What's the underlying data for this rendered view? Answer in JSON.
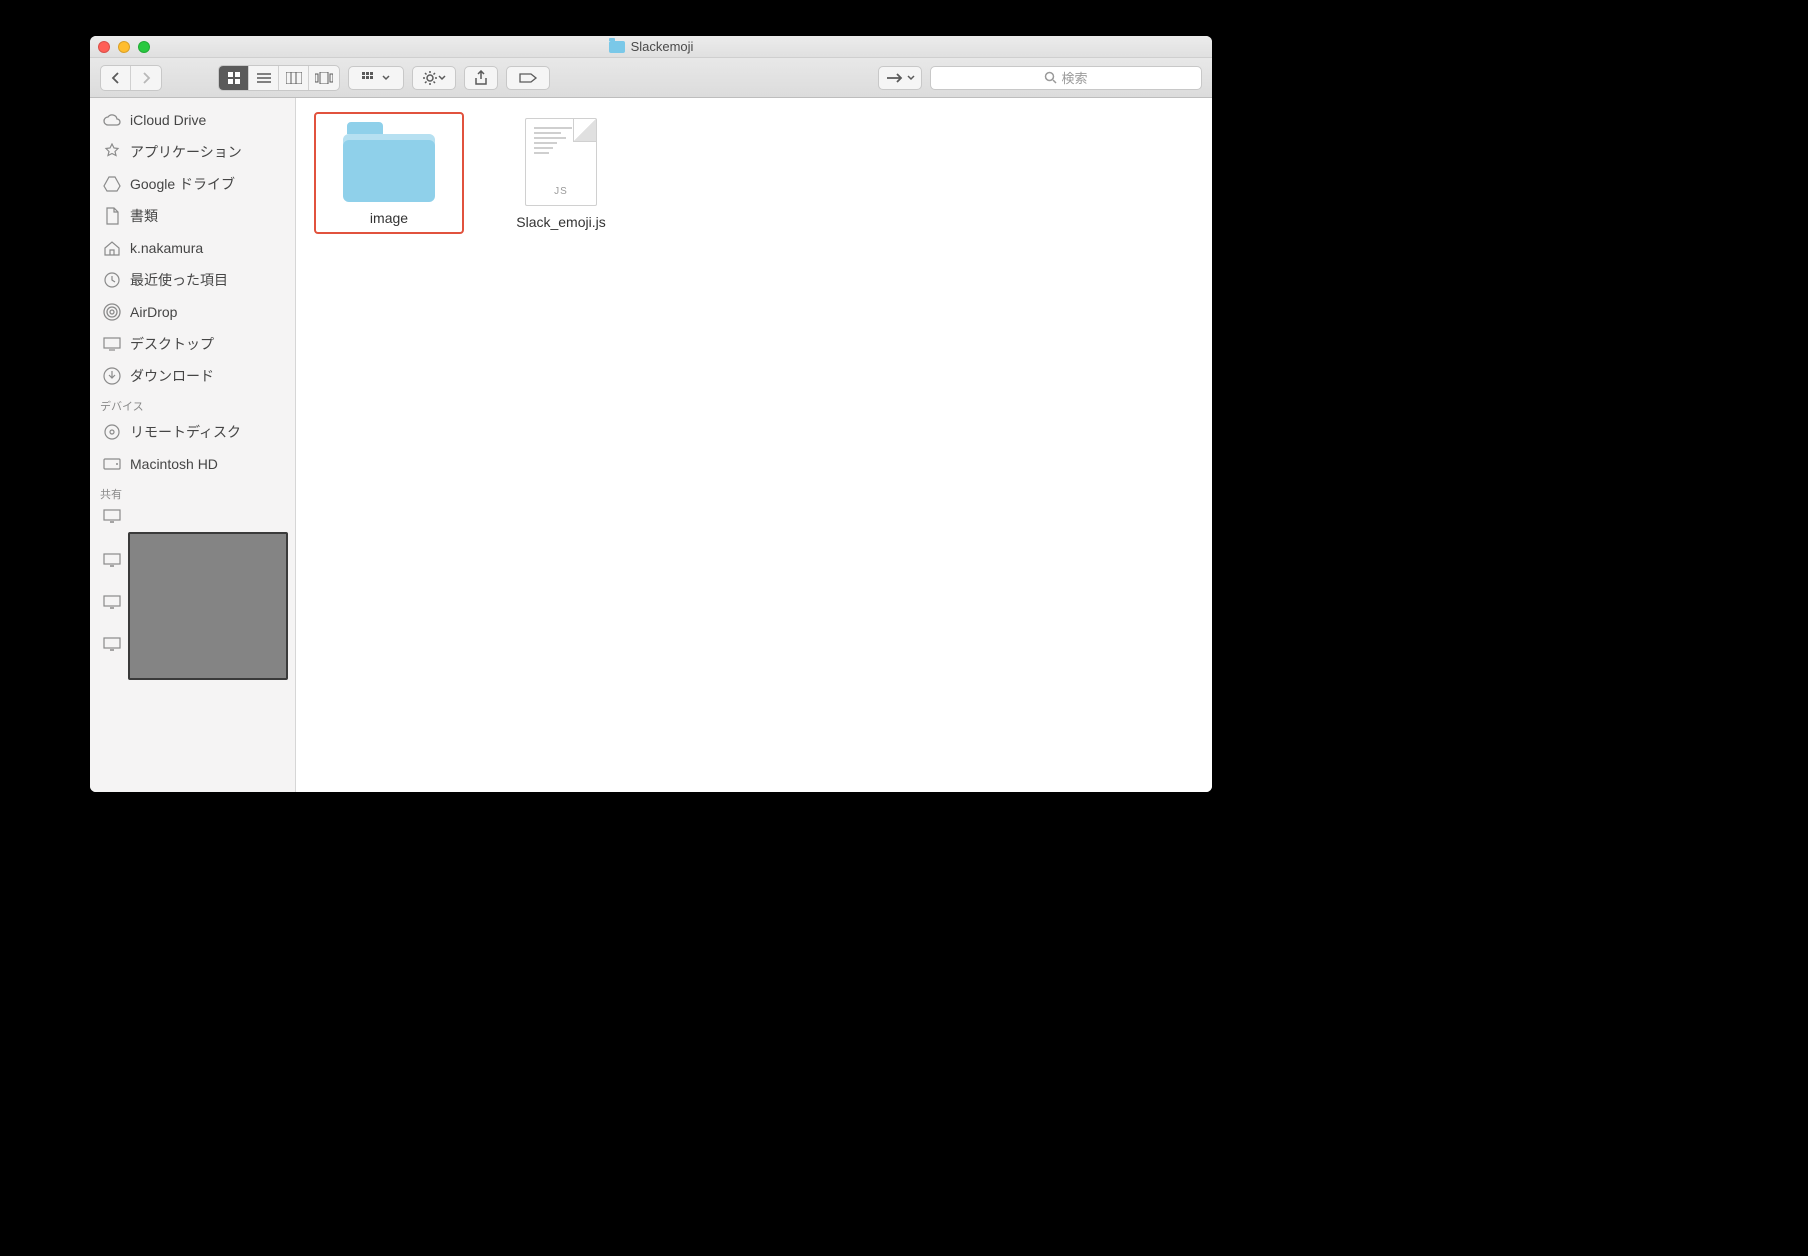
{
  "window": {
    "title": "Slackemoji"
  },
  "search": {
    "placeholder": "検索"
  },
  "sidebar": {
    "favorites": [
      {
        "icon": "cloud",
        "label": "iCloud Drive"
      },
      {
        "icon": "apps",
        "label": "アプリケーション"
      },
      {
        "icon": "gdrive",
        "label": "Google ドライブ"
      },
      {
        "icon": "doc",
        "label": "書類"
      },
      {
        "icon": "home",
        "label": "k.nakamura"
      },
      {
        "icon": "clock",
        "label": "最近使った項目"
      },
      {
        "icon": "airdrop",
        "label": "AirDrop"
      },
      {
        "icon": "desktop",
        "label": "デスクトップ"
      },
      {
        "icon": "download",
        "label": "ダウンロード"
      }
    ],
    "devices_header": "デバイス",
    "devices": [
      {
        "icon": "disc",
        "label": "リモートディスク"
      },
      {
        "icon": "hdd",
        "label": "Macintosh HD"
      }
    ],
    "shared_header": "共有"
  },
  "items": [
    {
      "type": "folder",
      "name": "image",
      "selected": true
    },
    {
      "type": "js",
      "name": "Slack_emoji.js",
      "selected": false,
      "badge": "JS"
    }
  ]
}
